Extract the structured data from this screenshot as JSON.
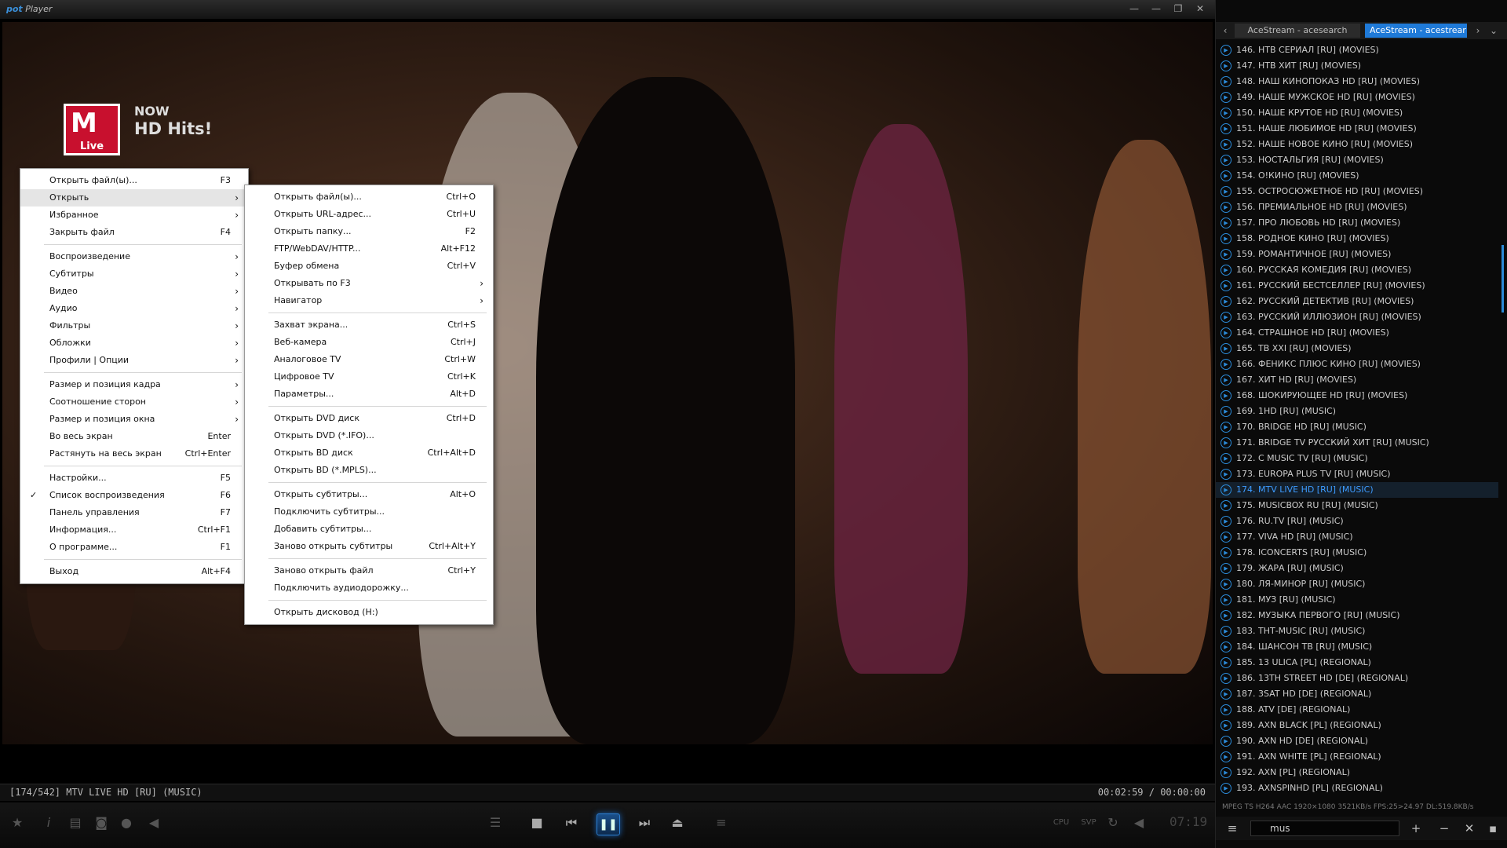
{
  "app": {
    "logo_pot": "pot",
    "logo_player": "Player",
    "win": [
      "—",
      "—",
      "❐",
      "✕"
    ]
  },
  "video": {
    "channel_now": "NOW",
    "channel_title": "HD Hits!",
    "mtv_m": "M",
    "mtv_live": "Live"
  },
  "main_menu": [
    {
      "label": "Открыть файл(ы)...",
      "shortcut": "F3"
    },
    {
      "label": "Открыть",
      "submenu": true,
      "highlight": true
    },
    {
      "label": "Избранное",
      "submenu": true
    },
    {
      "label": "Закрыть файл",
      "shortcut": "F4"
    },
    {
      "sep": true
    },
    {
      "label": "Воспроизведение",
      "submenu": true
    },
    {
      "label": "Субтитры",
      "submenu": true
    },
    {
      "label": "Видео",
      "submenu": true
    },
    {
      "label": "Аудио",
      "submenu": true
    },
    {
      "label": "Фильтры",
      "submenu": true
    },
    {
      "label": "Обложки",
      "submenu": true
    },
    {
      "label": "Профили | Опции",
      "submenu": true
    },
    {
      "sep": true
    },
    {
      "label": "Размер и позиция кадра",
      "submenu": true
    },
    {
      "label": "Соотношение сторон",
      "submenu": true
    },
    {
      "label": "Размер и позиция окна",
      "submenu": true
    },
    {
      "label": "Во весь экран",
      "shortcut": "Enter"
    },
    {
      "label": "Растянуть на весь экран",
      "shortcut": "Ctrl+Enter"
    },
    {
      "sep": true
    },
    {
      "label": "Настройки...",
      "shortcut": "F5"
    },
    {
      "label": "Список воспроизведения",
      "shortcut": "F6",
      "checked": true
    },
    {
      "label": "Панель управления",
      "shortcut": "F7"
    },
    {
      "label": "Информация...",
      "shortcut": "Ctrl+F1"
    },
    {
      "label": "О программе...",
      "shortcut": "F1"
    },
    {
      "sep": true
    },
    {
      "label": "Выход",
      "shortcut": "Alt+F4"
    }
  ],
  "open_menu": [
    {
      "label": "Открыть файл(ы)...",
      "shortcut": "Ctrl+O"
    },
    {
      "label": "Открыть URL-адрес...",
      "shortcut": "Ctrl+U"
    },
    {
      "label": "Открыть папку...",
      "shortcut": "F2"
    },
    {
      "label": "FTP/WebDAV/HTTP...",
      "shortcut": "Alt+F12"
    },
    {
      "label": "Буфер обмена",
      "shortcut": "Ctrl+V"
    },
    {
      "label": "Открывать по F3",
      "submenu": true
    },
    {
      "label": "Навигатор",
      "submenu": true
    },
    {
      "sep": true
    },
    {
      "label": "Захват экрана...",
      "shortcut": "Ctrl+S"
    },
    {
      "label": "Веб-камера",
      "shortcut": "Ctrl+J"
    },
    {
      "label": "Аналоговое TV",
      "shortcut": "Ctrl+W"
    },
    {
      "label": "Цифровое TV",
      "shortcut": "Ctrl+K"
    },
    {
      "label": "Параметры...",
      "shortcut": "Alt+D"
    },
    {
      "sep": true
    },
    {
      "label": "Открыть DVD диск",
      "shortcut": "Ctrl+D"
    },
    {
      "label": "Открыть DVD (*.IFO)..."
    },
    {
      "label": "Открыть BD диск",
      "shortcut": "Ctrl+Alt+D"
    },
    {
      "label": "Открыть BD (*.MPLS)..."
    },
    {
      "sep": true
    },
    {
      "label": "Открыть субтитры...",
      "shortcut": "Alt+O"
    },
    {
      "label": "Подключить субтитры..."
    },
    {
      "label": "Добавить субтитры..."
    },
    {
      "label": "Заново открыть субтитры",
      "shortcut": "Ctrl+Alt+Y"
    },
    {
      "sep": true
    },
    {
      "label": "Заново открыть файл",
      "shortcut": "Ctrl+Y"
    },
    {
      "label": "Подключить аудиодорожку..."
    },
    {
      "sep": true
    },
    {
      "label": "Открыть дисковод (H:)"
    }
  ],
  "status": {
    "now_playing": "[174/542] MTV LIVE HD [RU] (MUSIC)",
    "time": "00:02:59 / 00:00:00",
    "clock": "07:19",
    "cpu": "CPU",
    "svp": "SVP"
  },
  "playlist": {
    "tab1": "AceStream - acesearch",
    "tab2": "AceStream - acestrear",
    "items": [
      "146. НТВ СЕРИАЛ [RU] (MOVIES)",
      "147. НТВ ХИТ [RU] (MOVIES)",
      "148. НАШ КИНОПОКАЗ HD [RU] (MOVIES)",
      "149. НАШЕ МУЖСКОЕ HD [RU] (MOVIES)",
      "150. НАШЕ КРУТОЕ HD [RU] (MOVIES)",
      "151. НАШЕ ЛЮБИМОЕ HD [RU] (MOVIES)",
      "152. НАШЕ НОВОЕ КИНО [RU] (MOVIES)",
      "153. НОСТАЛЬГИЯ [RU] (MOVIES)",
      "154. О!КИНО [RU] (MOVIES)",
      "155. ОСТРОСЮЖЕТНОЕ HD [RU] (MOVIES)",
      "156. ПРЕМИАЛЬНОЕ HD [RU] (MOVIES)",
      "157. ПРО ЛЮБОВЬ HD [RU] (MOVIES)",
      "158. РОДНОЕ КИНО [RU] (MOVIES)",
      "159. РОМАНТИЧНОЕ [RU] (MOVIES)",
      "160. РУССКАЯ КОМЕДИЯ [RU] (MOVIES)",
      "161. РУССКИЙ БЕСТСЕЛЛЕР [RU] (MOVIES)",
      "162. РУССКИЙ ДЕТЕКТИВ [RU] (MOVIES)",
      "163. РУССКИЙ ИЛЛЮЗИОН [RU] (MOVIES)",
      "164. СТРАШНОЕ HD [RU] (MOVIES)",
      "165. ТВ XXI [RU] (MOVIES)",
      "166. ФЕНИКС ПЛЮС КИНО [RU] (MOVIES)",
      "167. ХИТ HD [RU] (MOVIES)",
      "168. ШОКИРУЮЩЕЕ HD [RU] (MOVIES)",
      "169. 1HD [RU] (MUSIC)",
      "170. BRIDGE HD [RU] (MUSIC)",
      "171. BRIDGE TV РУССКИЙ ХИТ [RU] (MUSIC)",
      "172. C MUSIC TV [RU] (MUSIC)",
      "173. EUROPA PLUS TV [RU] (MUSIC)",
      "174. MTV LIVE HD [RU] (MUSIC)",
      "175. MUSICBOX RU [RU] (MUSIC)",
      "176. RU.TV [RU] (MUSIC)",
      "177. VIVA HD [RU] (MUSIC)",
      "178. ICONCERTS [RU] (MUSIC)",
      "179. ЖАРА [RU] (MUSIC)",
      "180. ЛЯ-МИНОР [RU] (MUSIC)",
      "181. МУЗ [RU] (MUSIC)",
      "182. МУЗЫКА ПЕРВОГО [RU] (MUSIC)",
      "183. ТНТ-MUSIC [RU] (MUSIC)",
      "184. ШАНСОН ТВ [RU] (MUSIC)",
      "185. 13 ULICA [PL] (REGIONAL)",
      "186. 13TH STREET HD [DE] (REGIONAL)",
      "187. 3SAT HD [DE] (REGIONAL)",
      "188. ATV [DE] (REGIONAL)",
      "189. AXN BLACK [PL] (REGIONAL)",
      "190. AXN HD [DE] (REGIONAL)",
      "191. AXN WHITE [PL] (REGIONAL)",
      "192. AXN [PL] (REGIONAL)",
      "193. AXNSPINHD [PL] (REGIONAL)"
    ],
    "active_index": 28,
    "info": "MPEG TS  H264  AAC  1920×1080  3521KB/s  FPS:25>24.97  DL:519.8KB/s",
    "search_value": "mus"
  }
}
